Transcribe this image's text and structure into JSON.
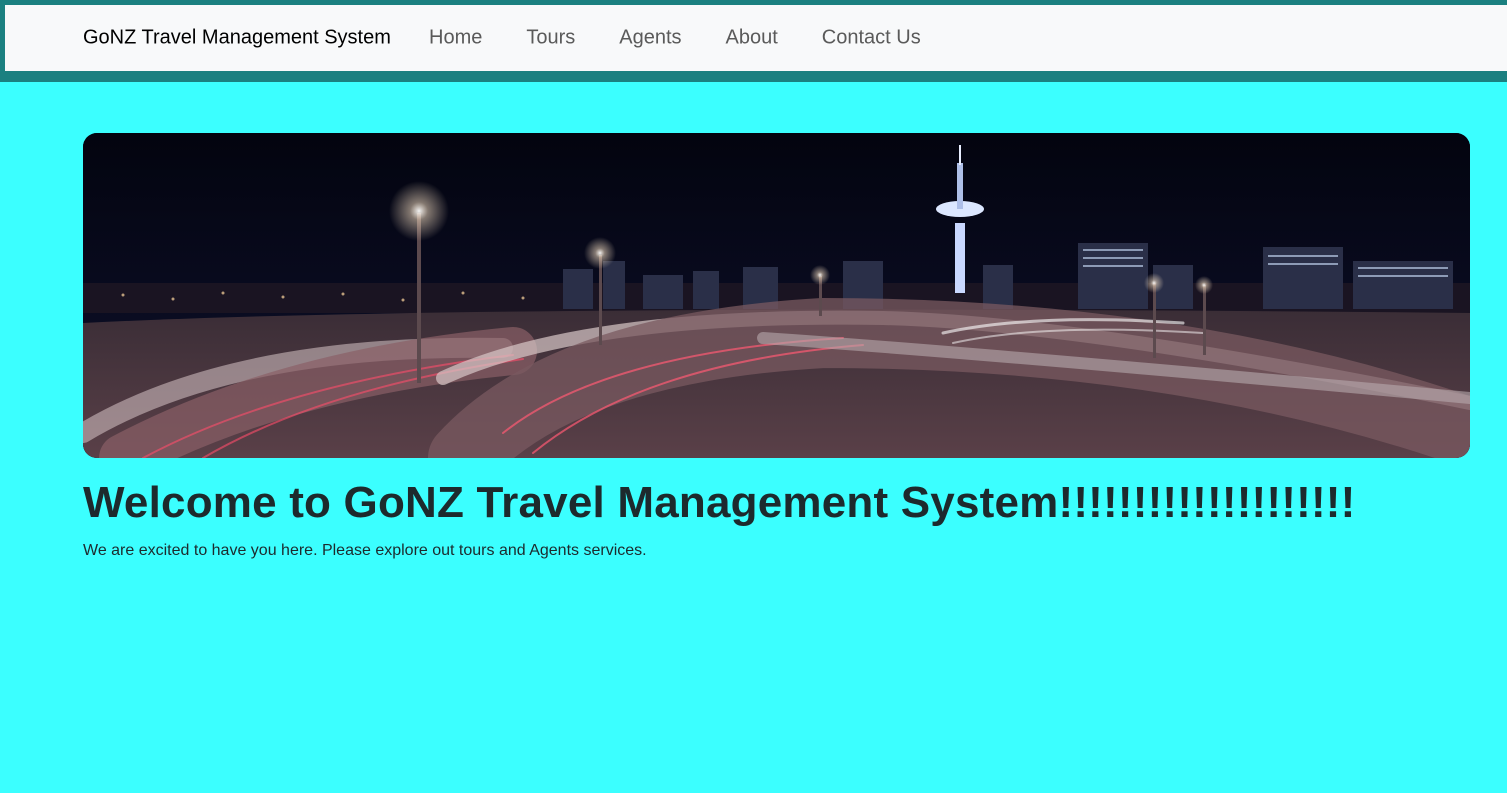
{
  "navbar": {
    "brand": "GoNZ Travel Management System",
    "links": [
      {
        "label": "Home"
      },
      {
        "label": "Tours"
      },
      {
        "label": "Agents"
      },
      {
        "label": "About"
      },
      {
        "label": "Contact Us"
      }
    ]
  },
  "hero": {
    "image": "night-city-motorway-photo"
  },
  "main": {
    "heading": "Welcome to GoNZ Travel Management System!!!!!!!!!!!!!!!!!!!!",
    "subtext": "We are excited to have you here. Please explore out tours and Agents services."
  },
  "colors": {
    "page_background": "#3bffff",
    "frame": "#1b8080",
    "navbar_background": "#f8f9fa",
    "nav_link": "#5a5a5a",
    "heading": "#1d2a2d"
  }
}
